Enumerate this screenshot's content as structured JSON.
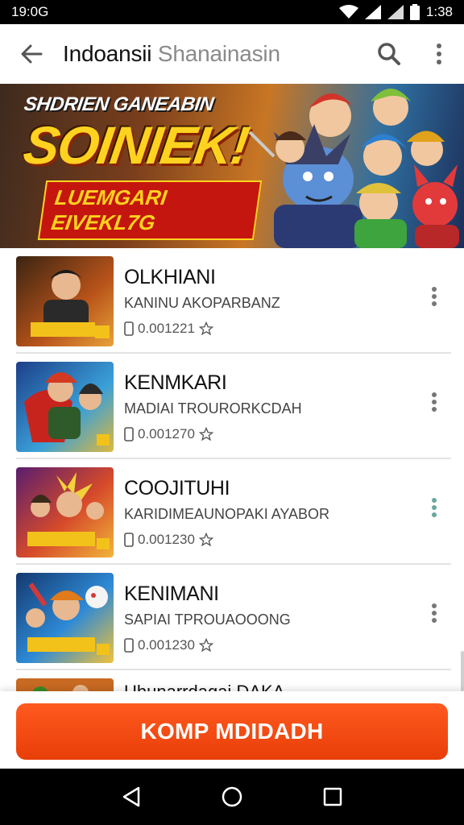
{
  "status_bar": {
    "left_time": "19:0G",
    "right_time": "1:38"
  },
  "app_bar": {
    "title_part1": "Indoansii",
    "title_part2": "Shanainasin",
    "icons": [
      "arrow-back-icon",
      "search-icon",
      "more-vert-icon"
    ]
  },
  "banner": {
    "subtitle": "SHDRIEN GANEABIN",
    "headline": "SOINIEK!",
    "ribbon": "LUEMGARI EIVEKL7G"
  },
  "list": {
    "items": [
      {
        "title": "OLKHIANI",
        "subtitle": "KANINU AKOPARBANZ",
        "meta": "0.001221",
        "thumb_colors": [
          "#3a2412",
          "#b8531a",
          "#e8a23a"
        ]
      },
      {
        "title": "KENMKARI",
        "subtitle": "MADIAI TROURORKCDAH",
        "meta": "0.001270",
        "thumb_colors": [
          "#1d3f8a",
          "#3aa0d8",
          "#e0b83a"
        ]
      },
      {
        "title": "COOJITUHI",
        "subtitle": "KARIDIMEAUNOPAKI AYABOR",
        "meta": "0.001230",
        "thumb_colors": [
          "#5a1e6e",
          "#d64a2a",
          "#f2b43a"
        ]
      },
      {
        "title": "KENIMANI",
        "subtitle": "SAPIAI TPROUAOOONG",
        "meta": "0.001230",
        "thumb_colors": [
          "#14386e",
          "#2e8ad6",
          "#f0c23a"
        ]
      }
    ],
    "partial_title": "Uhunarrdagai DAKA"
  },
  "cta": {
    "label": "KOMP MDIDADH",
    "color": "#ec4210"
  },
  "nav_bar": {
    "icons": [
      "nav-back-icon",
      "nav-home-icon",
      "nav-recents-icon"
    ]
  }
}
